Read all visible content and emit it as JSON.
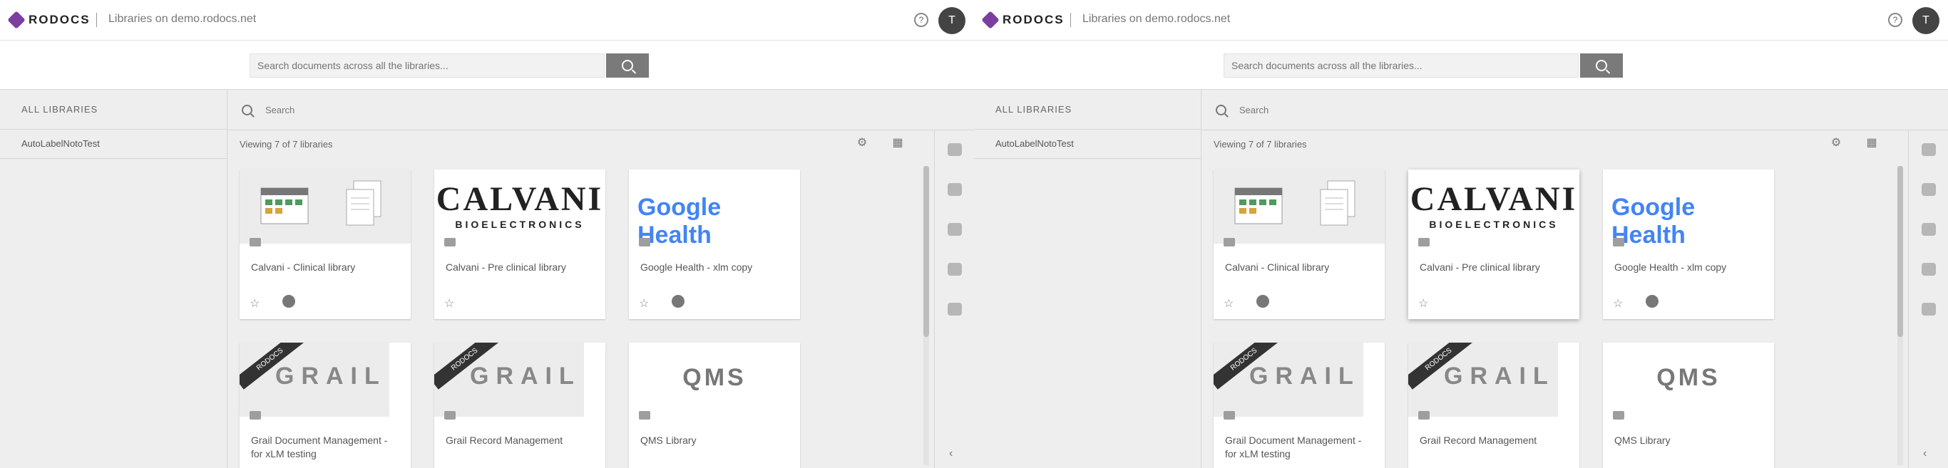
{
  "header": {
    "logo_text": "RODOCS",
    "brand_text": "Libraries on demo.rodocs.net",
    "user_initial": "T",
    "help_label": "?"
  },
  "search": {
    "placeholder": "Search documents across all the libraries..."
  },
  "sidebar": {
    "header": "ALL LIBRARIES",
    "items": [
      {
        "label": "AutoLabelNotoTest"
      }
    ]
  },
  "filter": {
    "placeholder": "Search"
  },
  "main": {
    "viewing_text": "Viewing 7 of 7 libraries",
    "cards": [
      {
        "title": "Calvani - Clinical library"
      },
      {
        "title": "Calvani - Pre clinical library",
        "logo_main": "CALVANI",
        "logo_sub": "BIOELECTRONICS"
      },
      {
        "title": "Google Health - xlm copy",
        "logo_text": "Google Health"
      },
      {
        "title": "Grail Document Management - for xLM testing",
        "logo_text": "GRAIL",
        "banner": "RODOCS"
      },
      {
        "title": "Grail Record Management",
        "logo_text": "GRAIL",
        "banner": "RODOCS"
      },
      {
        "title": "QMS Library",
        "logo_text": "QMS"
      }
    ]
  },
  "colors": {
    "accent": "#7b3fa0",
    "search_button": "#7a7a7a",
    "google_blue": "#4285f4",
    "google_red": "#ea4335",
    "google_yellow": "#fbbc05",
    "google_green": "#34a853"
  }
}
